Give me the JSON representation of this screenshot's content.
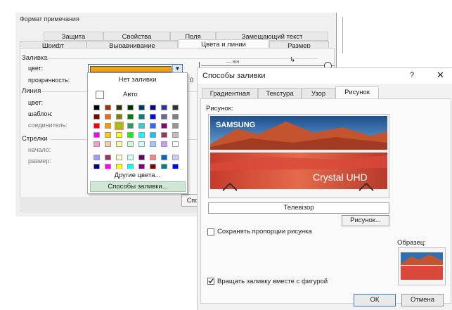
{
  "bg_dialog": {
    "title": "Формат примечания",
    "tabs_row1": [
      "Защита",
      "Свойства",
      "Поля",
      "Замещающий текст"
    ],
    "tabs_row2": [
      "Шрифт",
      "Выравнивание",
      "Цвета и линии",
      "Размер"
    ],
    "active_tab": "Цвета и линии",
    "fill_section": "Заливка",
    "color_label": "цвет:",
    "transparency_label": "прозрачность:",
    "transparency_value": "0",
    "line_section": "Линия",
    "line_color_label": "цвет:",
    "pattern_label": "шаблон:",
    "connector_label": "соединитель:",
    "arrows_section": "Стрелки",
    "start_label": "начало:",
    "size_label": "размер:",
    "fill_button_stub": "Спо",
    "selected_color": "#f0a010"
  },
  "palette": {
    "no_fill": "Нет заливки",
    "auto": "Авто",
    "other_colors": "Другие цвета...",
    "fill_methods": "Способы заливки...",
    "rows": [
      [
        "#000000",
        "#993300",
        "#333300",
        "#003300",
        "#003366",
        "#000080",
        "#333399",
        "#333333"
      ],
      [
        "#800000",
        "#ff6600",
        "#808000",
        "#008000",
        "#008080",
        "#0000ff",
        "#666699",
        "#808080"
      ],
      [
        "#ff0000",
        "#ff9900",
        "#99cc00",
        "#339966",
        "#33cccc",
        "#3366ff",
        "#800080",
        "#969696"
      ],
      [
        "#ff00ff",
        "#ffcc00",
        "#ffff00",
        "#00ff00",
        "#00ffff",
        "#00ccff",
        "#993366",
        "#c0c0c0"
      ],
      [
        "#ff99cc",
        "#ffcc99",
        "#ffff99",
        "#ccffcc",
        "#ccffff",
        "#99ccff",
        "#cc99ff",
        "#ffffff"
      ],
      [
        "#9999ff",
        "#993366",
        "#ffffcc",
        "#ccffff",
        "#660066",
        "#ff8080",
        "#0066cc",
        "#ccccff"
      ],
      [
        "#000080",
        "#ff00ff",
        "#ffff00",
        "#00ffff",
        "#800080",
        "#800000",
        "#008080",
        "#0000ff"
      ]
    ],
    "selected_swatch": "#99cc00"
  },
  "fg_dialog": {
    "title": "Способы заливки",
    "help": "?",
    "close": "✕",
    "tabs": [
      "Градиентная",
      "Текстура",
      "Узор",
      "Рисунок"
    ],
    "active_tab": "Рисунок",
    "picture_label": "Рисунок:",
    "picture_name": "Телевізор",
    "picture_button": "Рисунок...",
    "keep_proportions": "Сохранять пропорции рисунка",
    "keep_proportions_checked": false,
    "rotate_with_shape": "Вращать заливку вместе с фигурой",
    "rotate_with_shape_checked": true,
    "sample_label": "Образец:",
    "ok": "ОК",
    "cancel": "Отмена"
  },
  "tv_image": {
    "brand": "SAMSUNG",
    "model_text": "Crystal UHD",
    "colors": {
      "sky": "#2f6fb3",
      "mountain": "#c4542e",
      "water": "#d9483a"
    }
  },
  "residual": {
    "mini_text": "— юн"
  }
}
